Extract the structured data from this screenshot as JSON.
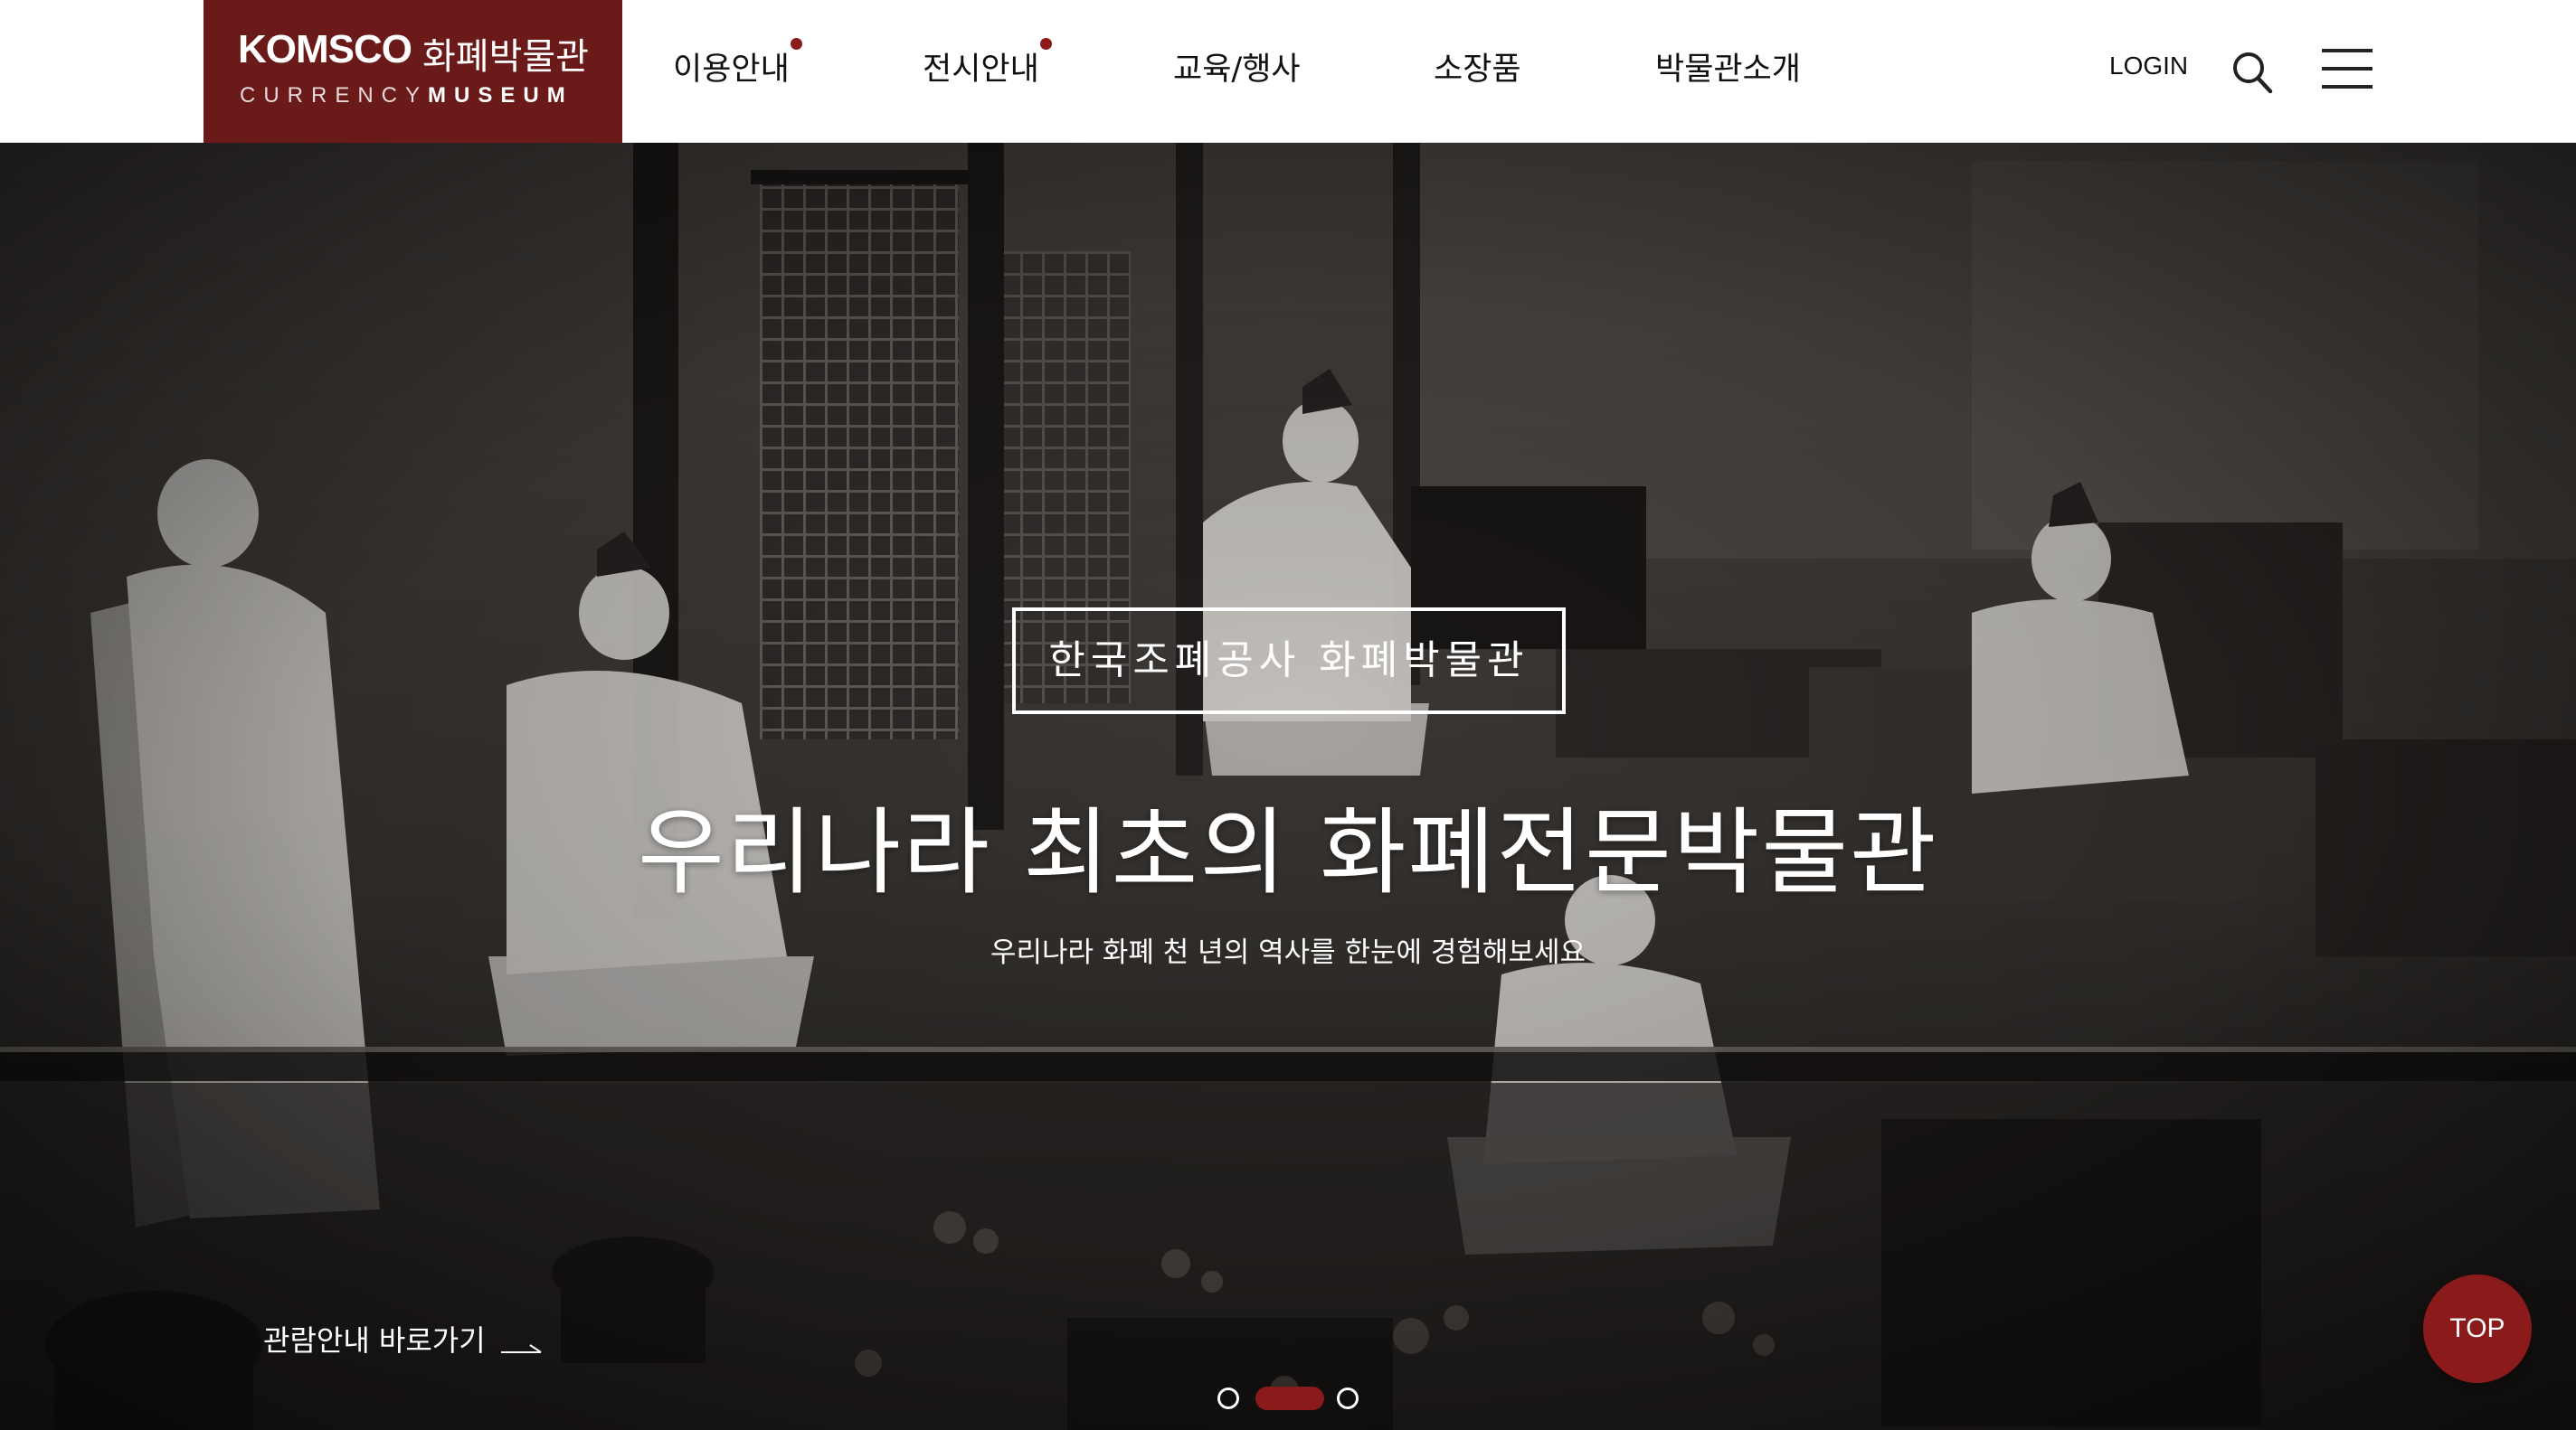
{
  "header": {
    "logo": {
      "brand": "KOMSCO",
      "name": "화폐박물관",
      "sub_light": "CURRENCY",
      "sub_bold": "MUSEUM"
    },
    "nav": [
      {
        "label": "이용안내",
        "has_dot": true
      },
      {
        "label": "전시안내",
        "has_dot": true
      },
      {
        "label": "교육/행사",
        "has_dot": false
      },
      {
        "label": "소장품",
        "has_dot": false
      },
      {
        "label": "박물관소개",
        "has_dot": false
      }
    ],
    "login_label": "LOGIN",
    "icons": [
      "search-icon",
      "hamburger-menu-icon"
    ]
  },
  "hero": {
    "badge": "한국조폐공사 화폐박물관",
    "title": "우리나라 최초의 화폐전문박물관",
    "subtitle": "우리나라 화폐 천 년의 역사를 한눈에 경험해보세요",
    "link_label": "관람안내 바로가기",
    "slides": {
      "count": 3,
      "active": 2
    }
  },
  "top_button_label": "TOP",
  "colors": {
    "brand": "#6b1a1a",
    "accent": "#8b1a1a",
    "header_bg": "#ffffff",
    "text_dark": "#111111"
  }
}
